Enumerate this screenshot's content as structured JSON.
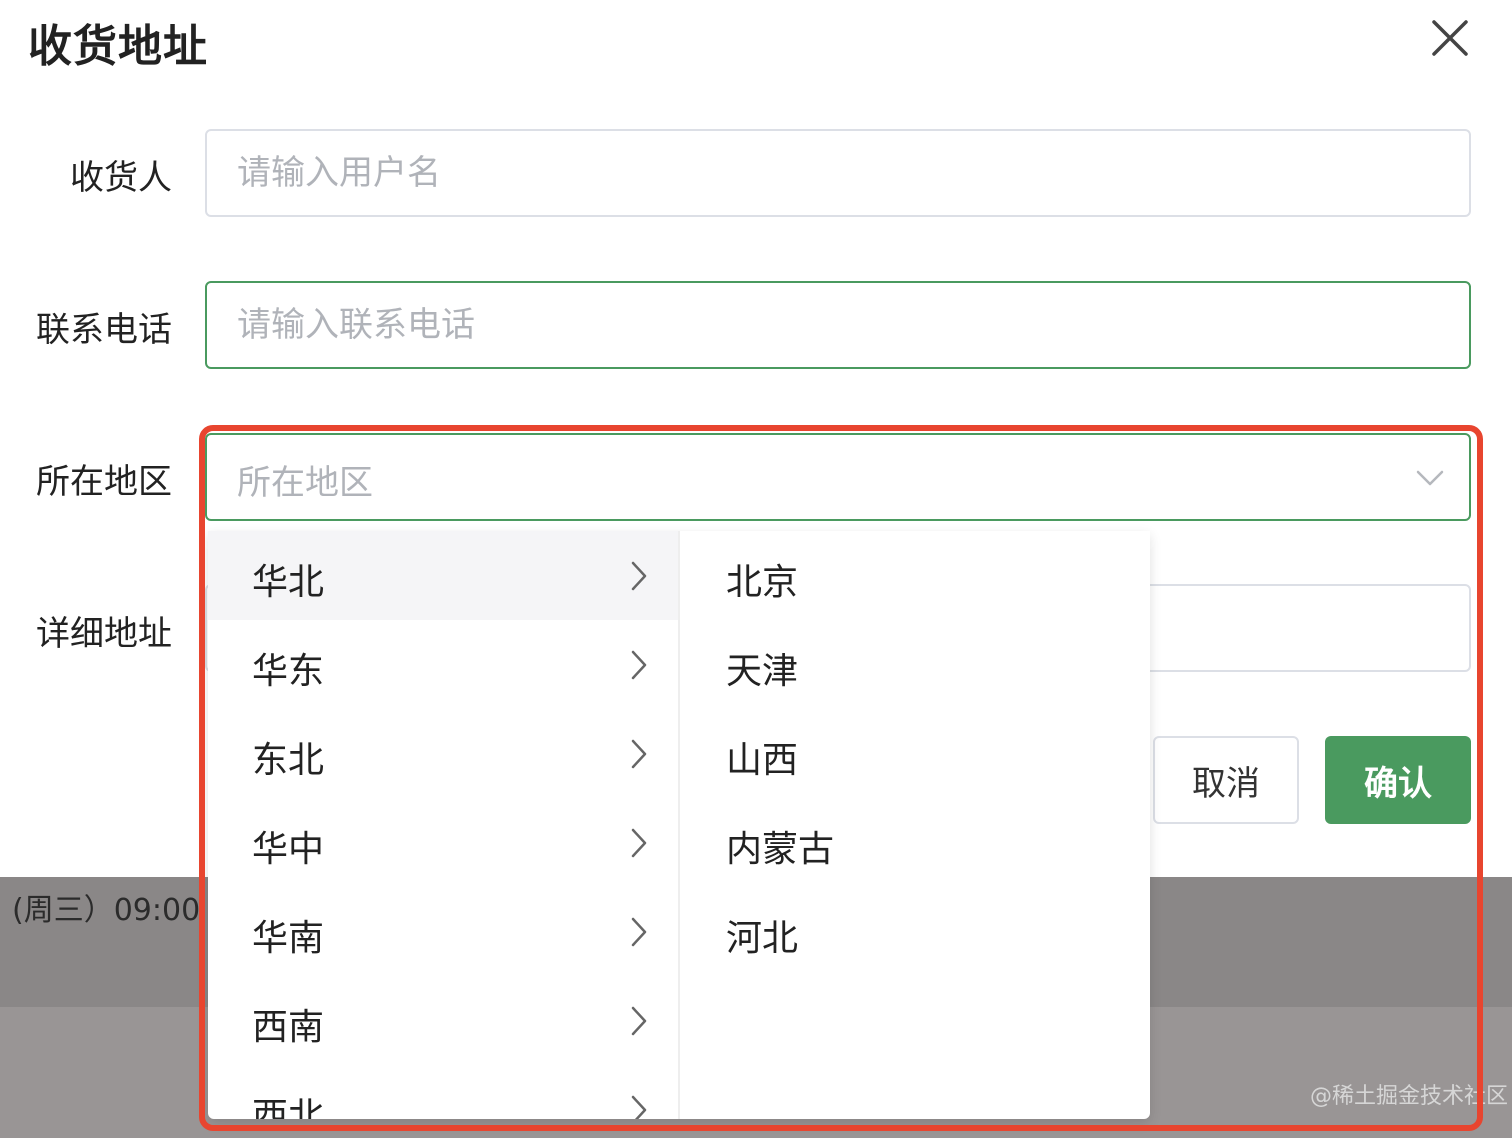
{
  "dialog": {
    "title": "收货地址",
    "close_icon": "close-icon"
  },
  "form": {
    "receiver": {
      "label": "收货人",
      "placeholder": "请输入用户名"
    },
    "phone": {
      "label": "联系电话",
      "placeholder": "请输入联系电话"
    },
    "region": {
      "label": "所在地区",
      "placeholder": "所在地区",
      "icon": "chevron-down-icon"
    },
    "detail": {
      "label": "详细地址",
      "placeholder": ""
    }
  },
  "buttons": {
    "cancel": "取消",
    "confirm": "确认"
  },
  "cascader": {
    "regions": [
      "华北",
      "华东",
      "东北",
      "华中",
      "华南",
      "西南",
      "西北"
    ],
    "active_region": "华北",
    "provinces": [
      "北京",
      "天津",
      "山西",
      "内蒙古",
      "河北"
    ]
  },
  "background": {
    "text": "(周三）09:00",
    "watermark": "@稀土掘金技术社区"
  },
  "colors": {
    "accent": "#4a9a5f",
    "highlight_frame": "#e8452f",
    "placeholder": "#b0b3b9"
  }
}
